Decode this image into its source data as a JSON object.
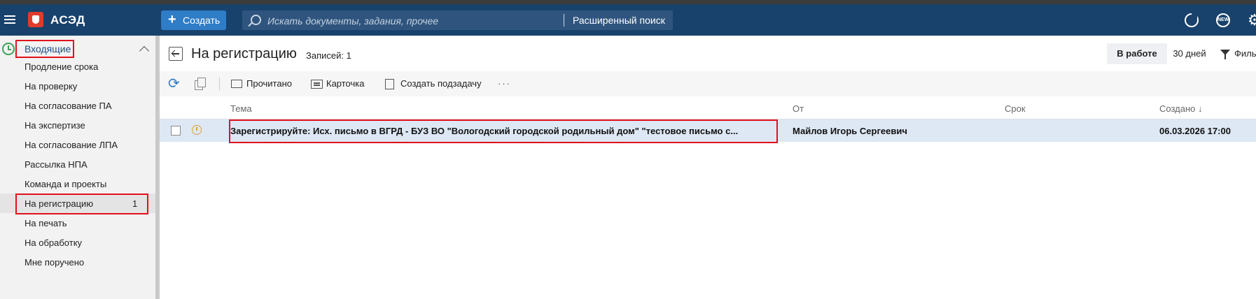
{
  "header": {
    "app_title": "АСЭД",
    "create_label": "Создать",
    "search_placeholder": "Искать документы, задания, прочее",
    "advanced_search_label": "Расширенный поиск"
  },
  "sidebar": {
    "section_title": "Входящие",
    "items": [
      {
        "label": "Продление срока"
      },
      {
        "label": "На проверку"
      },
      {
        "label": "На согласование ПА"
      },
      {
        "label": "На экспертизе"
      },
      {
        "label": "На согласование ЛПА"
      },
      {
        "label": "Рассылка НПА"
      },
      {
        "label": "Команда и проекты"
      },
      {
        "label": "На регистрацию",
        "count": "1",
        "active": true
      },
      {
        "label": "На печать"
      },
      {
        "label": "На обработку"
      },
      {
        "label": "Мне поручено"
      }
    ]
  },
  "main": {
    "title": "На регистрацию",
    "records_label": "Записей: 1",
    "in_work_label": "В работе",
    "period_label": "30 дней",
    "filter_label": "Фильтр"
  },
  "toolbar": {
    "read_label": "Прочитано",
    "card_label": "Карточка",
    "create_subtask_label": "Создать подзадачу",
    "more_label": "···"
  },
  "grid": {
    "columns": {
      "subject": "Тема",
      "from": "От",
      "deadline": "Срок",
      "created": "Создано ↓"
    },
    "rows": [
      {
        "subject": "Зарегистрируйте: Исх. письмо в ВГРД - БУЗ ВО \"Вологодский городской родильный дом\" \"тестовое письмо с...",
        "from": "Майлов Игорь Сергеевич",
        "deadline": "",
        "created": "06.03.2026 17:00"
      }
    ]
  },
  "colors": {
    "topbar": "#18426c",
    "accent": "#2f7cc7",
    "highlight_border": "#e3101b",
    "selected_row": "#dde8f4"
  }
}
